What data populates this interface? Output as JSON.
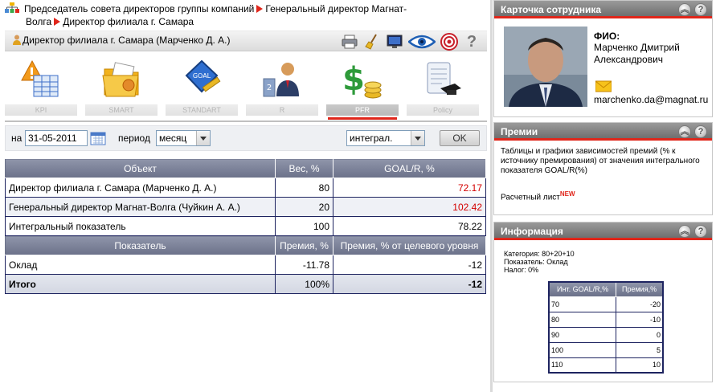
{
  "breadcrumb": {
    "item1": "Председатель совета директоров группы компаний",
    "item2": "Генеральный директор Магнат-",
    "item2_cont": "Волга",
    "item3": "Директор филиала г. Самара"
  },
  "header": {
    "person": "Директор филиала г. Самара  (Марченко Д. А.)",
    "help": "?"
  },
  "nav": [
    {
      "label": "KPI"
    },
    {
      "label": "SMART"
    },
    {
      "label": "STANDART"
    },
    {
      "label": "R"
    },
    {
      "label": "PFR"
    },
    {
      "label": "Policy"
    }
  ],
  "filter": {
    "date_label": "на",
    "date_value": "31-05-2011",
    "period_label": "период",
    "period_value": "месяц",
    "mode_value": "интеграл.",
    "ok_label": "OK"
  },
  "table1": {
    "headers": [
      "Объект",
      "Вес, %",
      "GOAL/R, %"
    ],
    "rows": [
      {
        "name": "Директор филиала г. Самара (Марченко Д. А.)",
        "weight": "80",
        "goal": "72.17"
      },
      {
        "name": "Генеральный директор Магнат-Волга (Чуйкин А. А.)",
        "weight": "20",
        "goal": "102.42"
      },
      {
        "name": "Интегральный показатель",
        "weight": "100",
        "goal": "78.22"
      }
    ]
  },
  "table2": {
    "headers": [
      "Показатель",
      "Премия, %",
      "Премия, % от целевого уровня"
    ],
    "rows": [
      {
        "name": "Оклад",
        "bonus": "-11.78",
        "target": "-12"
      }
    ],
    "total": {
      "name": "Итого",
      "bonus": "100%",
      "target": "-12"
    }
  },
  "card": {
    "title": "Карточка сотрудника",
    "fio_label": "ФИО:",
    "name_line1": "Марченко Дмитрий",
    "name_line2": "Александрович",
    "email": "marchenko.da@magnat.ru"
  },
  "premii": {
    "title": "Премии",
    "text": "Таблицы и графики зависимостей премий (% к источнику премирования) от значения интегрального показателя GOAL/R(%)",
    "link": "Расчетный лист",
    "badge": "NEW"
  },
  "info": {
    "title": "Информация",
    "category": "Категория: 80+20+10",
    "indicator": "Показатель: Оклад",
    "tax": "Налог: 0%",
    "headers": [
      "Инт. GOAL/R,%",
      "Премия,%"
    ],
    "rows": [
      {
        "k": "70",
        "v": "-20"
      },
      {
        "k": "80",
        "v": "-10"
      },
      {
        "k": "90",
        "v": "0"
      },
      {
        "k": "100",
        "v": "5"
      },
      {
        "k": "110",
        "v": "10"
      }
    ]
  },
  "colors": {
    "accent_red": "#e0261b",
    "navy": "#1e2460",
    "value_red": "#d40000"
  }
}
